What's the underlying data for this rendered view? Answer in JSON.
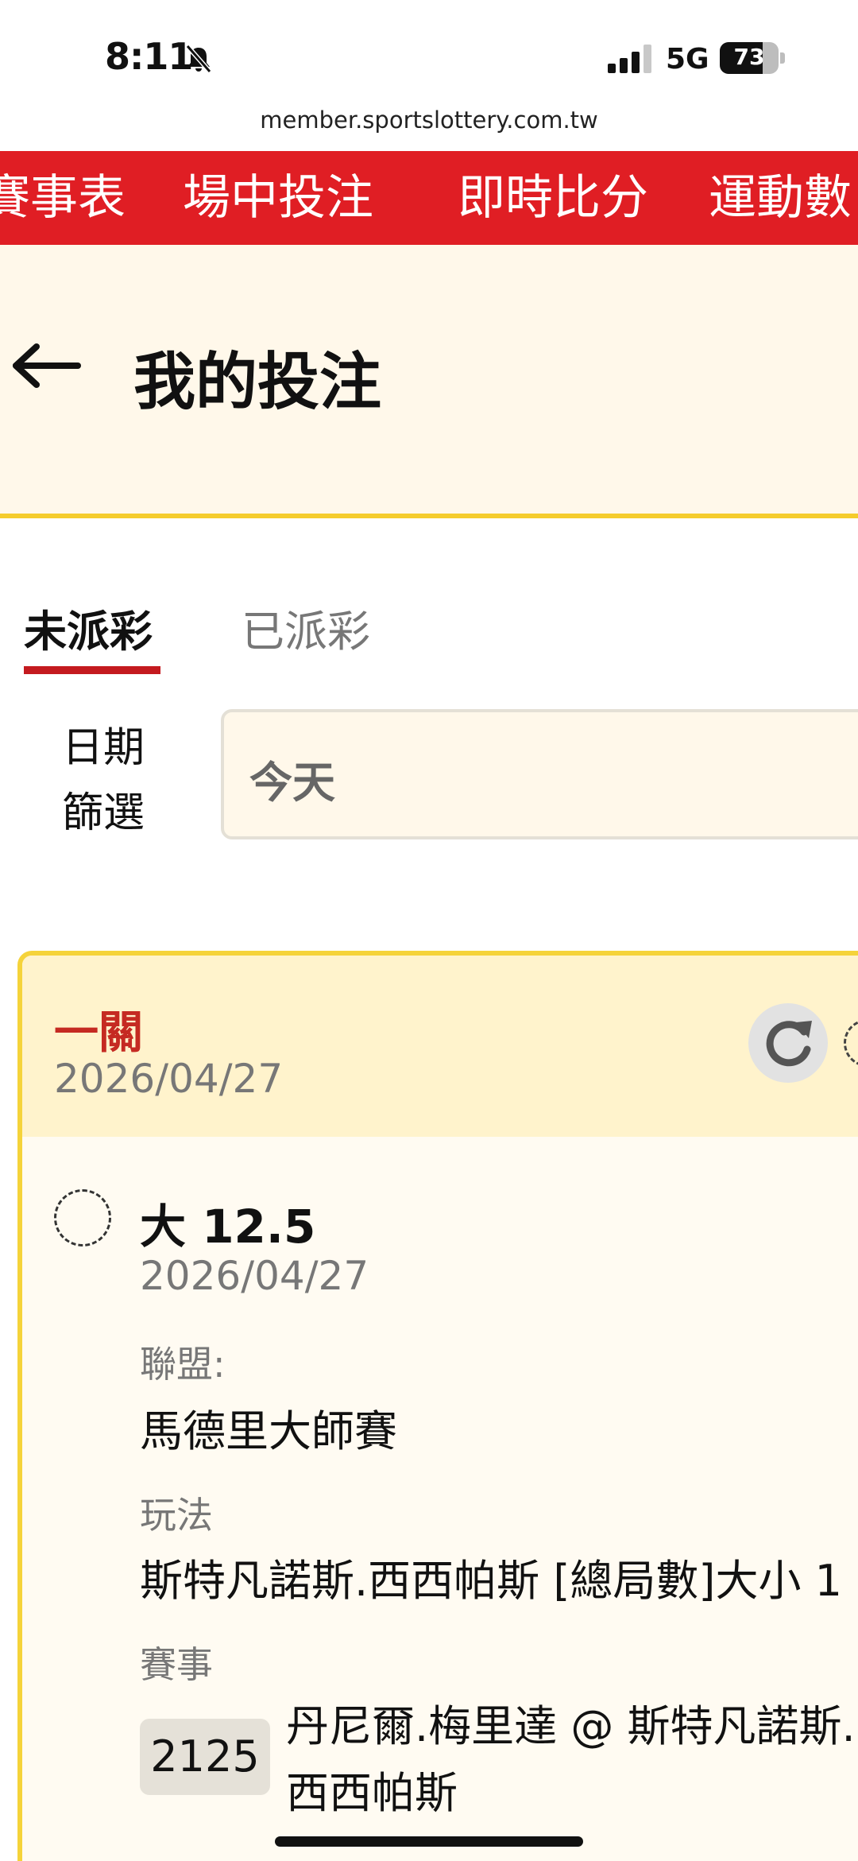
{
  "status_bar": {
    "time": "8:11",
    "network": "5G",
    "battery": "73",
    "battery_level_percent": 73
  },
  "browser": {
    "url": "member.sportslottery.com.tw"
  },
  "topnav": {
    "items": [
      "賽事表",
      "場中投注",
      "即時比分",
      "運動數"
    ]
  },
  "header": {
    "title": "我的投注"
  },
  "tabs": {
    "unsettled": "未派彩",
    "settled": "已派彩"
  },
  "filter": {
    "label_line1": "日期",
    "label_line2": "篩選",
    "value": "今天"
  },
  "card": {
    "bet_type": "一關",
    "date": "2026/04/27",
    "selection": {
      "title": "大 12.5",
      "date": "2026/04/27",
      "league_label": "聯盟:",
      "league": "馬德里大師賽",
      "play_label": "玩法",
      "play": "斯特凡諾斯.西西帕斯 [總局數]大小 1",
      "match_label": "賽事",
      "match_id": "2125",
      "match": "丹尼爾.梅里達 @ 斯特凡諾斯.西西帕斯"
    }
  },
  "colors": {
    "nav_red": "#e01e24",
    "header_bg": "#fff8ea",
    "accent_yellow": "#f5cc2c",
    "tab_underline": "#c41a1f",
    "bet_type_red": "#c52a22"
  }
}
